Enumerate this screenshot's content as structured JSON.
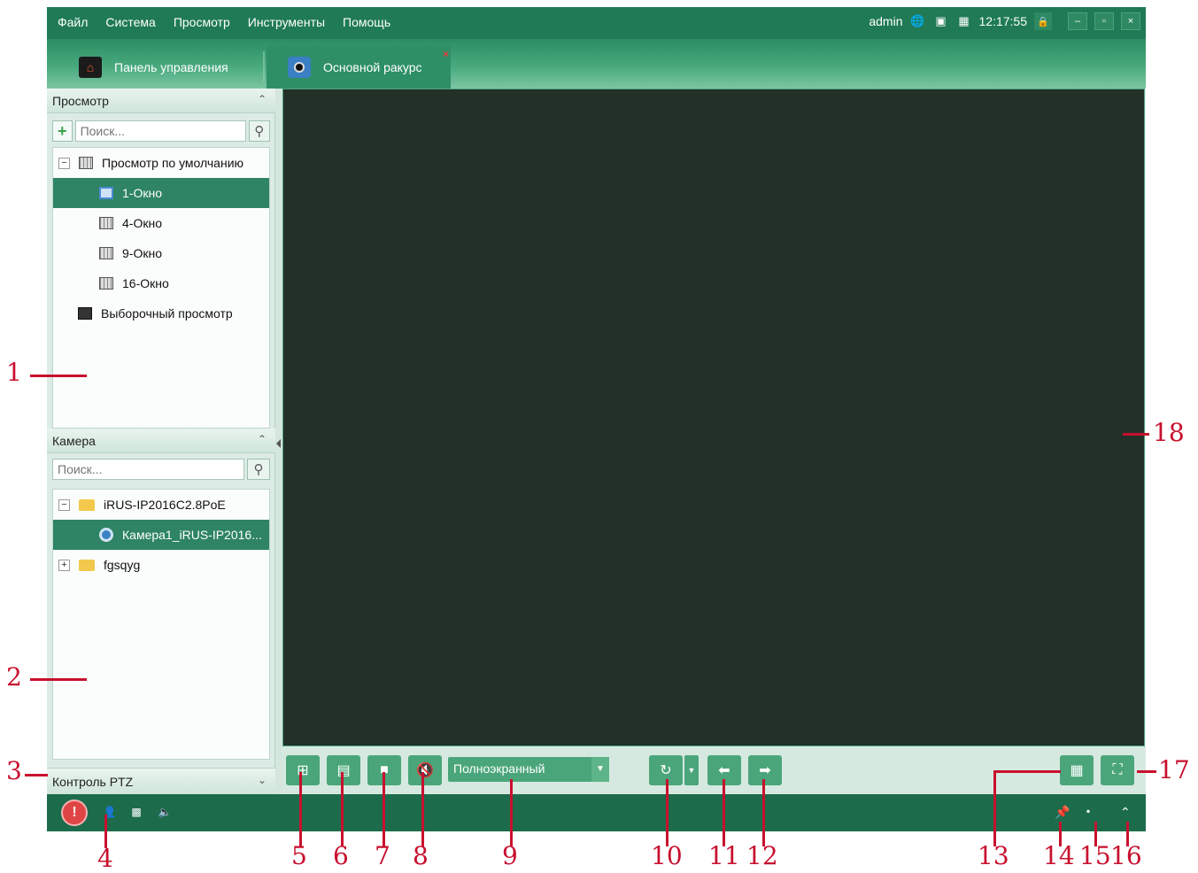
{
  "menu": {
    "items": [
      "Файл",
      "Система",
      "Просмотр",
      "Инструменты",
      "Помощь"
    ],
    "user": "admin",
    "time": "12:17:55"
  },
  "tabs": [
    {
      "label": "Панель управления"
    },
    {
      "label": "Основной ракурс"
    }
  ],
  "view_panel": {
    "title": "Просмотр",
    "search_placeholder": "Поиск...",
    "default_group": "Просмотр по умолчанию",
    "layouts": [
      "1-Окно",
      "4-Окно",
      "9-Окно",
      "16-Окно"
    ],
    "custom": "Выборочный просмотр"
  },
  "camera_panel": {
    "title": "Камера",
    "search_placeholder": "Поиск...",
    "device": "iRUS-IP2016C2.8PoE",
    "camera": "Камера1_iRUS-IP2016...",
    "group": "fgsqyg"
  },
  "ptz": {
    "title": "Контроль PTZ"
  },
  "toolbar": {
    "mode": "Полноэкранный"
  },
  "annotations": [
    "1",
    "2",
    "3",
    "4",
    "5",
    "6",
    "7",
    "8",
    "9",
    "10",
    "11",
    "12",
    "13",
    "14",
    "15",
    "16",
    "17",
    "18"
  ],
  "colors": {
    "primary": "#1f7a55",
    "accent": "#4aa67a",
    "selected": "#2e8464",
    "annotation": "#c8102e"
  }
}
